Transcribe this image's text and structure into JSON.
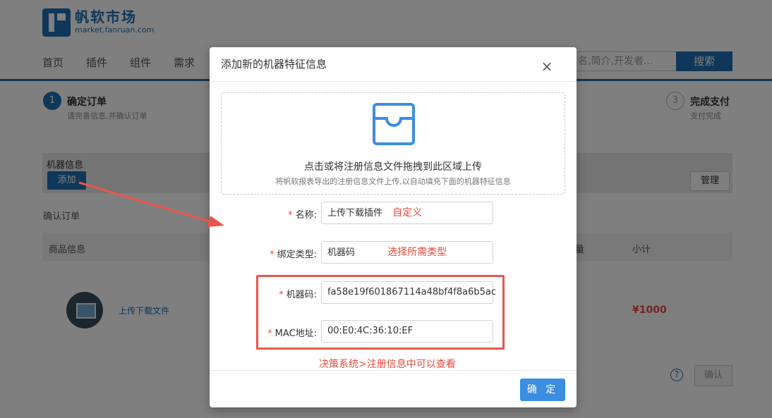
{
  "header": {
    "logo_title": "帆软市场",
    "logo_sub": "market.fanruan.com",
    "nav": [
      "首页",
      "插件",
      "组件",
      "需求"
    ],
    "search_placeholder": "名,简介,开发者...",
    "search_button": "搜索"
  },
  "steps": [
    {
      "number": "1",
      "title": "确定订单",
      "desc": "请完善信息,并确认订单"
    },
    {
      "number": "3",
      "title": "完成支付",
      "desc": "支付完成"
    }
  ],
  "machine_info": {
    "label": "机器信息",
    "add_button": "添加",
    "manage_button": "管理"
  },
  "order": {
    "section_label": "确认订单",
    "col_product": "商品信息",
    "col_qty": "量",
    "col_subtotal": "小计",
    "product_name": "上传下载文件",
    "price": "¥1000",
    "confirm_button": "确认",
    "help_icon": "?"
  },
  "dialog": {
    "title": "添加新的机器特征信息",
    "close": "×",
    "upload_main": "点击或将注册信息文件拖拽到此区域上传",
    "upload_hint": "将帆软报表导出的注册信息文件上传,以自动填充下面的机器特征信息",
    "fields": {
      "name_label": "名称:",
      "name_value": "上传下载插件",
      "name_note": "自定义",
      "bind_label": "绑定类型:",
      "bind_value": "机器码",
      "bind_note": "选择所需类型",
      "code_label": "机器码:",
      "code_value": "fa58e19f601867114a48bf4f8a6b5ac",
      "mac_label": "MAC地址:",
      "mac_value": "00:E0:4C:36:10:EF"
    },
    "required_mark": "*",
    "highlight_note": "决策系统>注册信息中可以查看",
    "ok_button": "确 定"
  },
  "colors": {
    "brand": "#1f6fb2",
    "primary_button": "#3b8ee0",
    "annotation_red": "#e8574d"
  }
}
